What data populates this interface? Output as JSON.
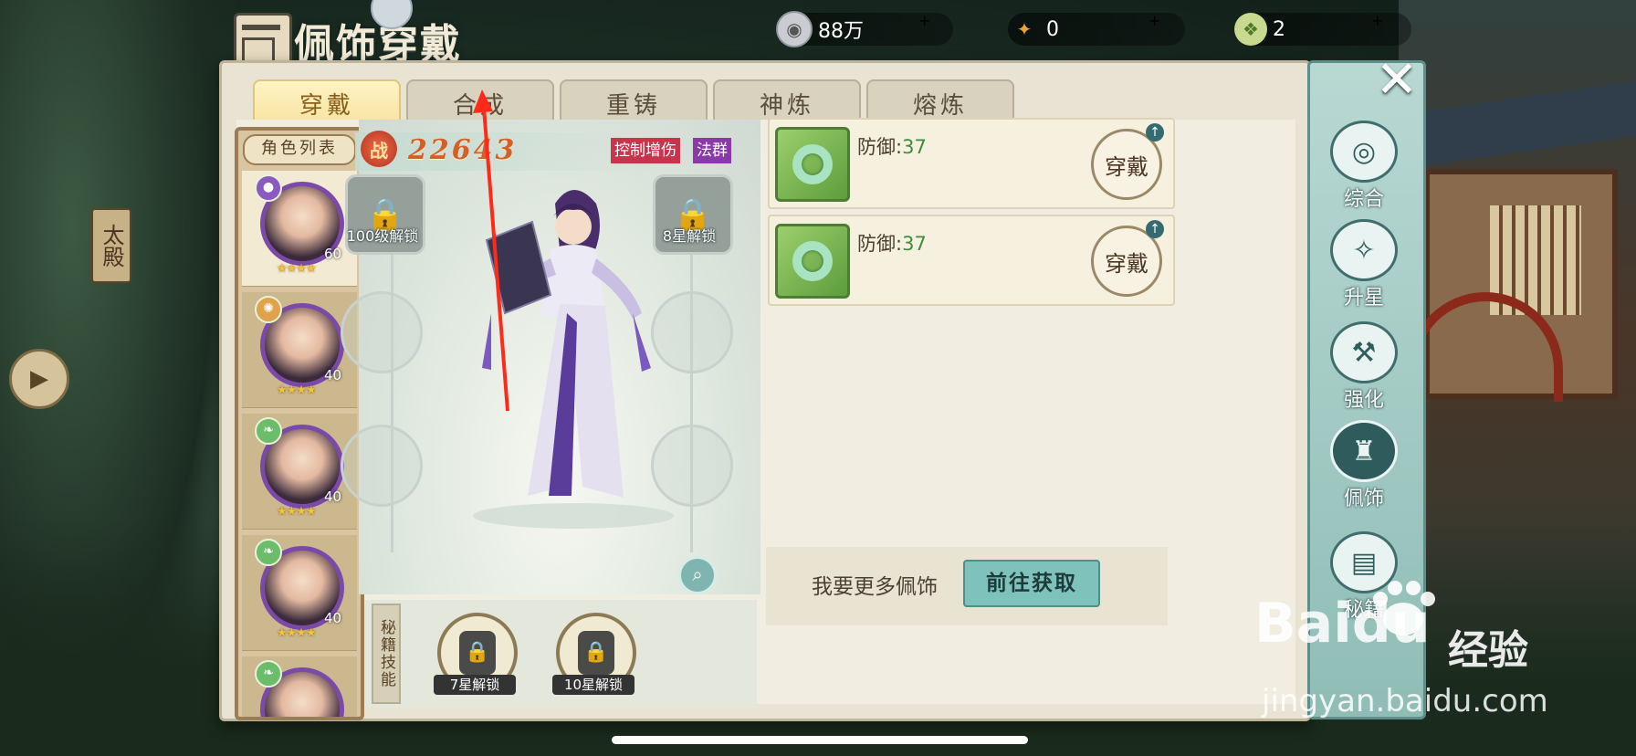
{
  "window": {
    "title": "佩饰穿戴"
  },
  "currencies": [
    {
      "icon": "silver-coin-icon",
      "value": "88万"
    },
    {
      "icon": "gold-flame-icon",
      "value": "0"
    },
    {
      "icon": "jade-token-icon",
      "value": "2"
    }
  ],
  "background": {
    "sign": "太殿"
  },
  "tabs": [
    {
      "label": "穿戴",
      "active": true
    },
    {
      "label": "合成",
      "active": false
    },
    {
      "label": "重铸",
      "active": false
    },
    {
      "label": "神炼",
      "active": false
    },
    {
      "label": "熔炼",
      "active": false
    }
  ],
  "role_list": {
    "title": "角色列表",
    "roles": [
      {
        "level": "60",
        "stars": "★★★★",
        "active": true
      },
      {
        "level": "40",
        "stars": "★★★★",
        "active": false
      },
      {
        "level": "40",
        "stars": "★★★★",
        "active": false
      },
      {
        "level": "40",
        "stars": "★★★★",
        "active": false
      },
      {
        "level": "",
        "stars": "",
        "active": false
      }
    ]
  },
  "character": {
    "power_badge": "战",
    "power_value": "22643",
    "tags": [
      "控制增伤",
      "法群"
    ]
  },
  "slots": {
    "left_lock": "100级解锁",
    "right_lock": "8星解锁"
  },
  "secret_skills": {
    "label": "秘籍技能",
    "locks": [
      "7星解锁",
      "10星解锁"
    ]
  },
  "equipment": [
    {
      "stat_label": "防御:",
      "stat_value": "37",
      "button": "穿戴"
    },
    {
      "stat_label": "防御:",
      "stat_value": "37",
      "button": "穿戴"
    }
  ],
  "more": {
    "text": "我要更多佩饰",
    "button": "前往获取"
  },
  "right_nav": [
    {
      "label": "综合",
      "icon": "swirl-icon",
      "active": false
    },
    {
      "label": "升星",
      "icon": "stars-icon",
      "active": false
    },
    {
      "label": "强化",
      "icon": "anvil-icon",
      "active": false
    },
    {
      "label": "佩饰",
      "icon": "accessory-icon",
      "active": true
    },
    {
      "label": "秘籍",
      "icon": "book-icon",
      "active": false
    }
  ],
  "watermark": {
    "brand": "Baidu",
    "cn": "经验",
    "url": "jingyan.baidu.com"
  },
  "colors": {
    "accent_red": "#c7344c",
    "accent_teal": "#7fc2bc",
    "power": "#d55f2a"
  }
}
